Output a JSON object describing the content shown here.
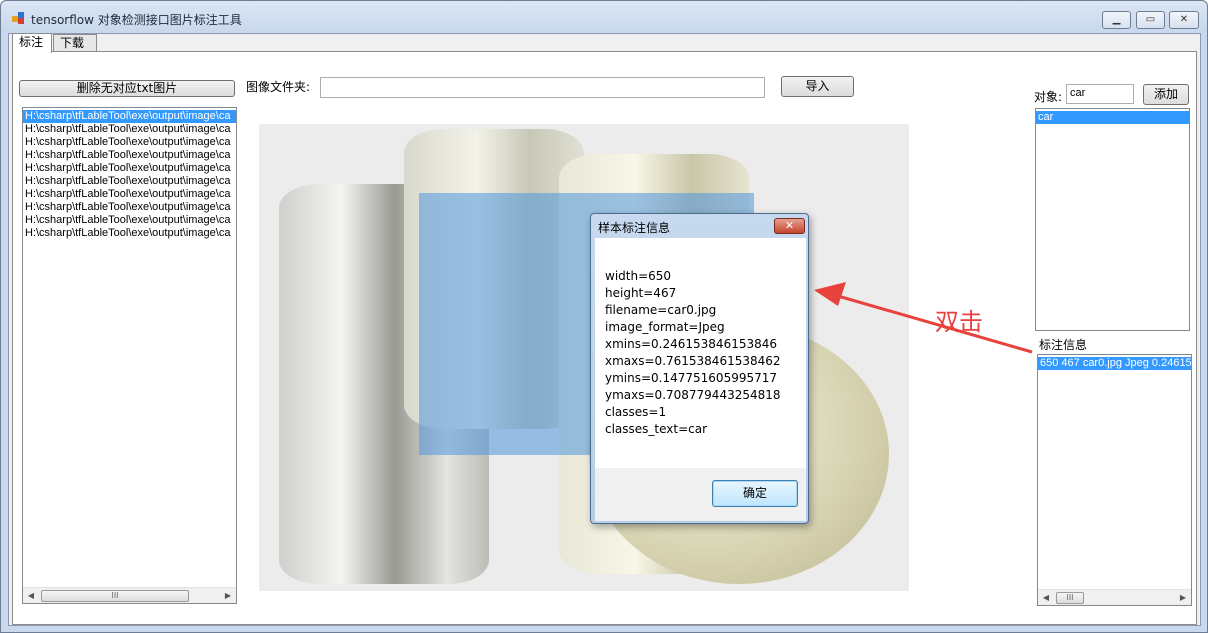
{
  "window": {
    "title": "tensorflow 对象检测接口图片标注工具",
    "controls": [
      "minimize",
      "maximize",
      "close"
    ]
  },
  "tabs": [
    {
      "label": "标注",
      "active": true
    },
    {
      "label": "下载",
      "active": false
    }
  ],
  "left_panel": {
    "delete_button_label": "删除无对应txt图片",
    "file_list": [
      "H:\\csharp\\tfLableTool\\exe\\output\\image\\ca",
      "H:\\csharp\\tfLableTool\\exe\\output\\image\\ca",
      "H:\\csharp\\tfLableTool\\exe\\output\\image\\ca",
      "H:\\csharp\\tfLableTool\\exe\\output\\image\\ca",
      "H:\\csharp\\tfLableTool\\exe\\output\\image\\ca",
      "H:\\csharp\\tfLableTool\\exe\\output\\image\\ca",
      "H:\\csharp\\tfLableTool\\exe\\output\\image\\ca",
      "H:\\csharp\\tfLableTool\\exe\\output\\image\\ca",
      "H:\\csharp\\tfLableTool\\exe\\output\\image\\ca",
      "H:\\csharp\\tfLableTool\\exe\\output\\image\\ca"
    ],
    "selected_index": 0,
    "scroll_thumb": "III"
  },
  "folder": {
    "label": "图像文件夹:",
    "value": "",
    "import_label": "导入"
  },
  "right_panel": {
    "object_label": "对象:",
    "object_value": "car",
    "add_label": "添加",
    "object_list": [
      "car"
    ],
    "annotation_label": "标注信息",
    "annotation_list": [
      "650 467 car0.jpg Jpeg 0.24615"
    ],
    "scroll_thumb": "III"
  },
  "dialog": {
    "title": "样本标注信息",
    "close_glyph": "✕",
    "lines": [
      "width=650",
      "height=467",
      "filename=car0.jpg",
      "image_format=Jpeg",
      "xmins=0.246153846153846",
      "xmaxs=0.761538461538462",
      "ymins=0.147751605995717",
      "ymaxs=0.708779443254818",
      "classes=1",
      "classes_text=car"
    ],
    "ok_label": "确定"
  },
  "annotation_text": "双击",
  "colors": {
    "selection": "#3399ff",
    "bbox": "#5096dc",
    "annotation": "#e8423c"
  }
}
